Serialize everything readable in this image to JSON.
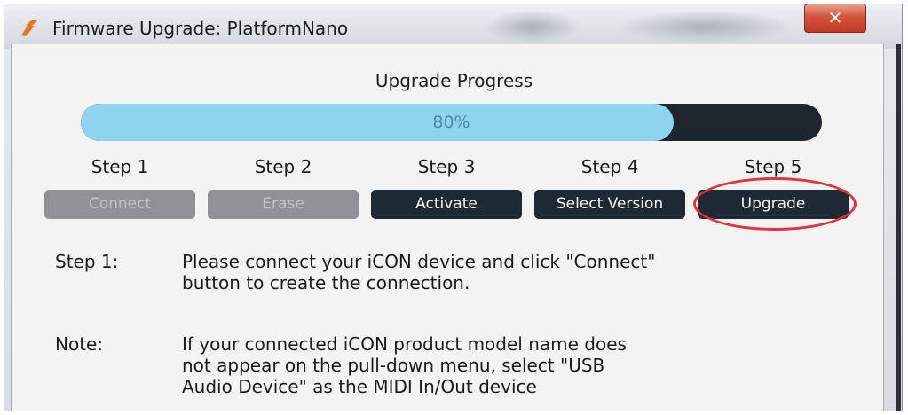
{
  "window": {
    "title": "Firmware Upgrade: PlatformNano",
    "close_glyph": "✕"
  },
  "progress": {
    "heading": "Upgrade Progress",
    "percent_text": "80%",
    "value": 0.8,
    "fill_color": "#8fd4ef",
    "track_color": "#1c252b"
  },
  "steps": [
    {
      "label": "Step 1",
      "button": "Connect",
      "state": "disabled"
    },
    {
      "label": "Step 2",
      "button": "Erase",
      "state": "disabled"
    },
    {
      "label": "Step 3",
      "button": "Activate",
      "state": "enabled"
    },
    {
      "label": "Step 4",
      "button": "Select Version",
      "state": "enabled"
    },
    {
      "label": "Step 5",
      "button": "Upgrade",
      "state": "enabled"
    }
  ],
  "instructions": {
    "step_label": "Step 1:",
    "step_lines": [
      "Please connect your iCON device and click \"Connect\"",
      "button to create the connection."
    ],
    "note_label": "Note:",
    "note_lines": [
      "If your connected iCON product model name does",
      "not appear on the pull-down menu, select \"USB",
      "Audio Device\" as the MIDI In/Out device"
    ]
  },
  "colors": {
    "highlight_ring": "#e0333b",
    "close_button": "#c23a22",
    "app_icon": "#e8761c"
  },
  "icons": {
    "app": "app-logo-icon",
    "close": "close-icon"
  }
}
